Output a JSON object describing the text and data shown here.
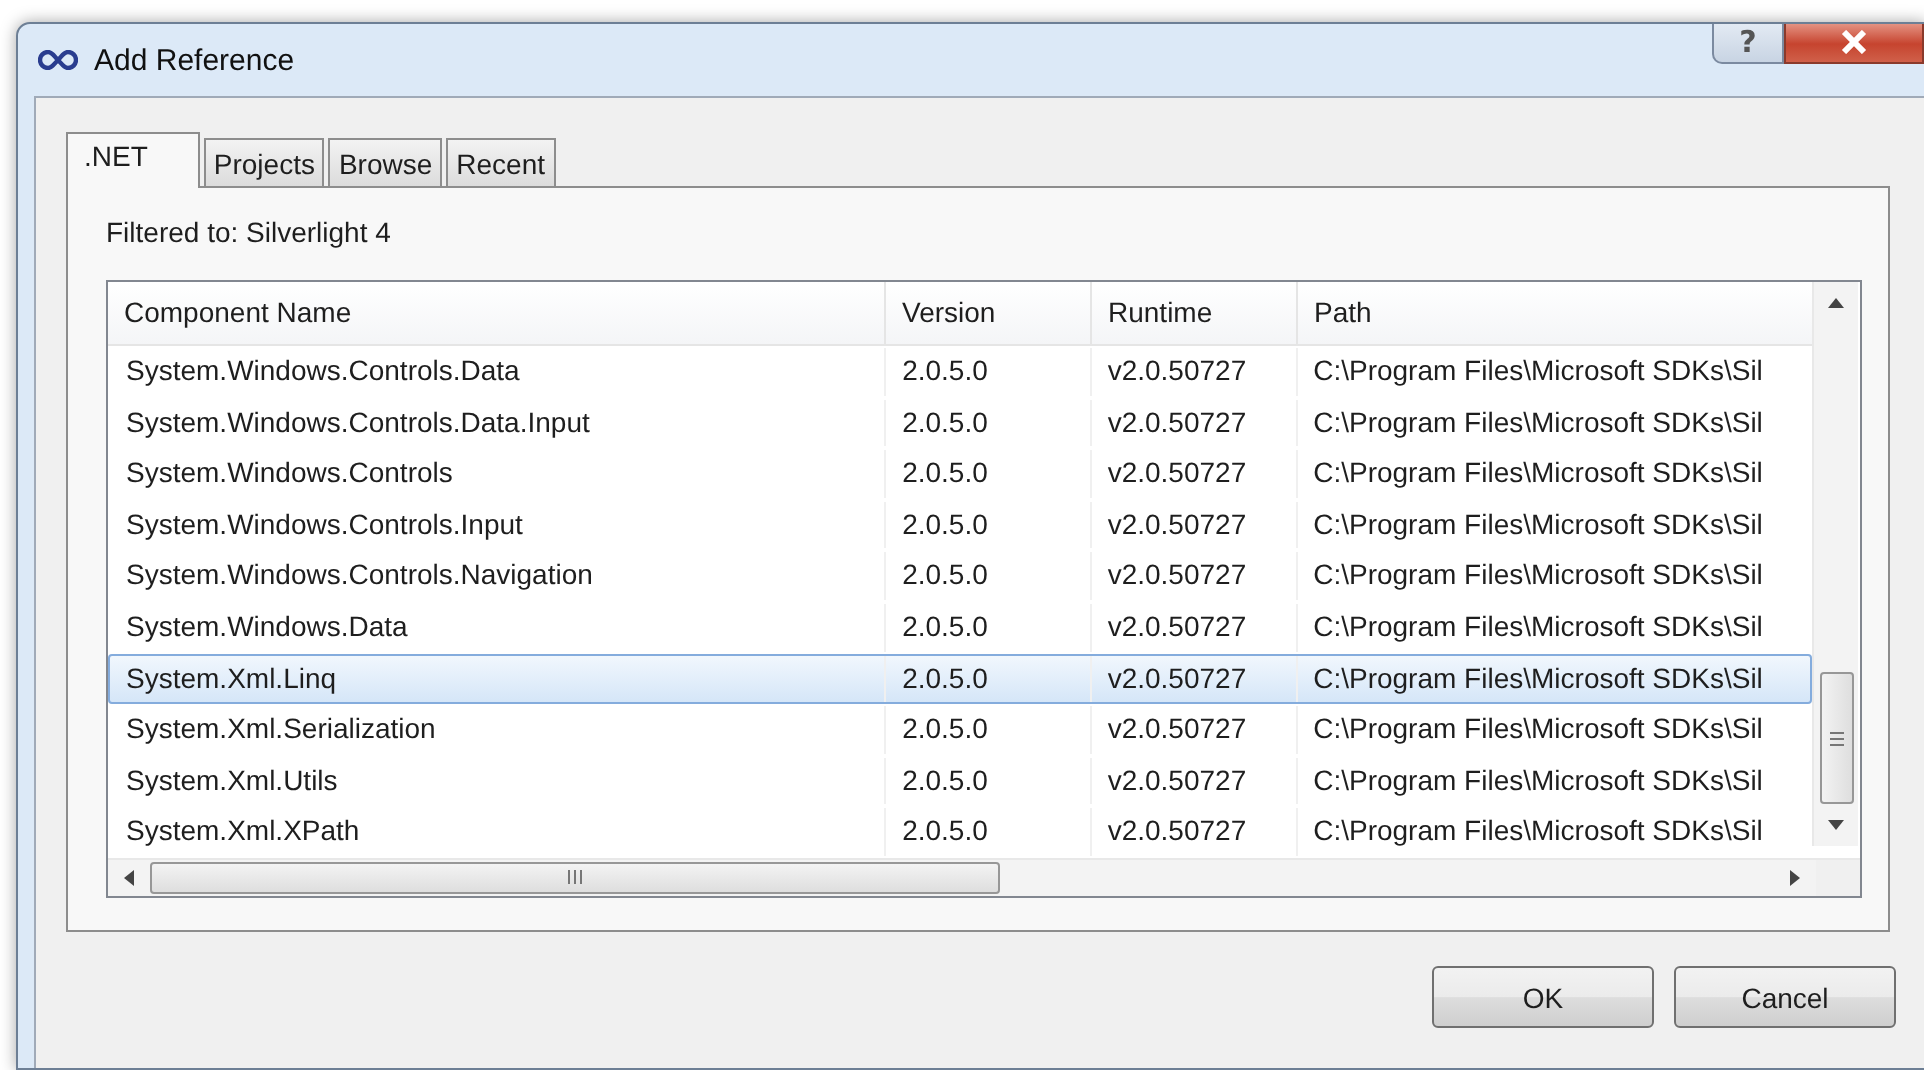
{
  "window": {
    "title": "Add Reference",
    "help_button": "?"
  },
  "tabs": [
    {
      "label": ".NET",
      "selected": true
    },
    {
      "label": "Projects",
      "selected": false
    },
    {
      "label": "Browse",
      "selected": false
    },
    {
      "label": "Recent",
      "selected": false
    }
  ],
  "filter_label": "Filtered to: Silverlight 4",
  "table": {
    "columns": [
      "Component Name",
      "Version",
      "Runtime",
      "Path"
    ],
    "rows": [
      {
        "cells": [
          "System.Windows.Controls.Data",
          "2.0.5.0",
          "v2.0.50727",
          "C:\\Program Files\\Microsoft SDKs\\Sil"
        ],
        "selected": false
      },
      {
        "cells": [
          "System.Windows.Controls.Data.Input",
          "2.0.5.0",
          "v2.0.50727",
          "C:\\Program Files\\Microsoft SDKs\\Sil"
        ],
        "selected": false
      },
      {
        "cells": [
          "System.Windows.Controls",
          "2.0.5.0",
          "v2.0.50727",
          "C:\\Program Files\\Microsoft SDKs\\Sil"
        ],
        "selected": false
      },
      {
        "cells": [
          "System.Windows.Controls.Input",
          "2.0.5.0",
          "v2.0.50727",
          "C:\\Program Files\\Microsoft SDKs\\Sil"
        ],
        "selected": false
      },
      {
        "cells": [
          "System.Windows.Controls.Navigation",
          "2.0.5.0",
          "v2.0.50727",
          "C:\\Program Files\\Microsoft SDKs\\Sil"
        ],
        "selected": false
      },
      {
        "cells": [
          "System.Windows.Data",
          "2.0.5.0",
          "v2.0.50727",
          "C:\\Program Files\\Microsoft SDKs\\Sil"
        ],
        "selected": false
      },
      {
        "cells": [
          "System.Xml.Linq",
          "2.0.5.0",
          "v2.0.50727",
          "C:\\Program Files\\Microsoft SDKs\\Sil"
        ],
        "selected": true
      },
      {
        "cells": [
          "System.Xml.Serialization",
          "2.0.5.0",
          "v2.0.50727",
          "C:\\Program Files\\Microsoft SDKs\\Sil"
        ],
        "selected": false
      },
      {
        "cells": [
          "System.Xml.Utils",
          "2.0.5.0",
          "v2.0.50727",
          "C:\\Program Files\\Microsoft SDKs\\Sil"
        ],
        "selected": false
      },
      {
        "cells": [
          "System.Xml.XPath",
          "2.0.5.0",
          "v2.0.50727",
          "C:\\Program Files\\Microsoft SDKs\\Sil"
        ],
        "selected": false
      }
    ]
  },
  "buttons": [
    "OK",
    "Cancel"
  ]
}
